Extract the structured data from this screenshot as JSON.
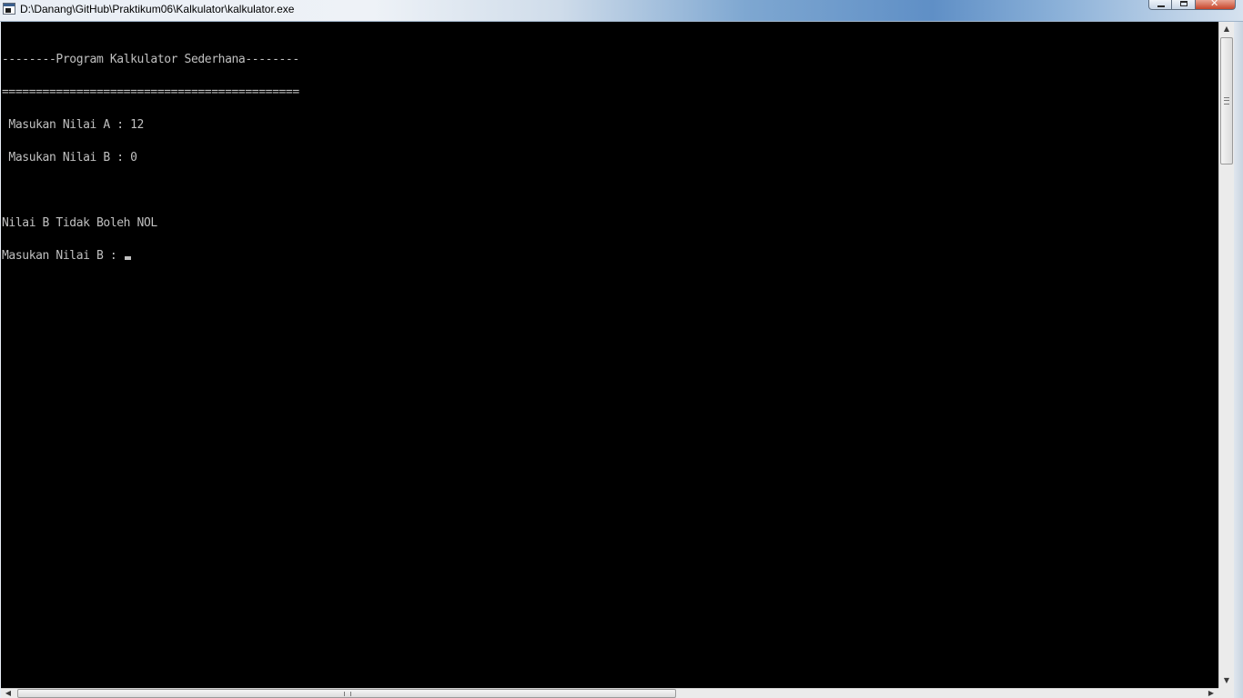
{
  "window": {
    "title": "D:\\Danang\\GitHub\\Praktikum06\\Kalkulator\\kalkulator.exe"
  },
  "console": {
    "lines": [
      "--------Program Kalkulator Sederhana--------",
      "============================================",
      " Masukan Nilai A : 12",
      " Masukan Nilai B : 0",
      "",
      "Nilai B Tidak Boleh NOL",
      "Masukan Nilai B : "
    ],
    "text_color": "#c0c0c0",
    "background_color": "#000000"
  },
  "icons": {
    "app": "console-app-icon",
    "minimize": "minimize-icon",
    "maximize": "maximize-icon",
    "close": "close-icon"
  }
}
